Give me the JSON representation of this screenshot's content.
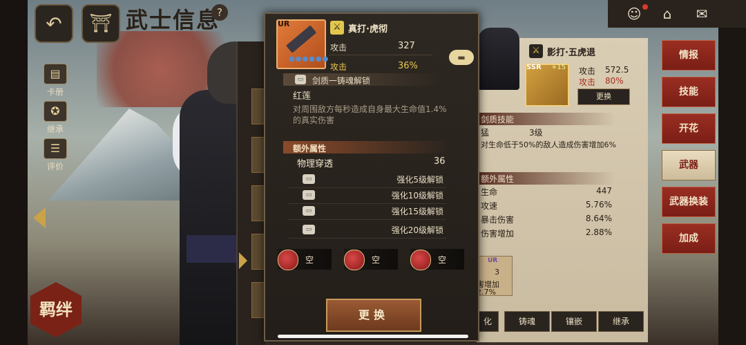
{
  "header": {
    "title": "武士信息",
    "help": "?"
  },
  "left_menu": [
    {
      "label": "卡册",
      "icon": "card-album-icon"
    },
    {
      "label": "继承",
      "icon": "inherit-icon"
    },
    {
      "label": "评价",
      "icon": "review-icon"
    }
  ],
  "bond_badge": "羁绊",
  "popup": {
    "weapon": {
      "rarity": "UR",
      "name": "真打·虎彻",
      "dots": "●●●●●●"
    },
    "stats": [
      {
        "label": "攻击",
        "value": "327"
      },
      {
        "label": "攻击",
        "value": "36%"
      }
    ],
    "skill": {
      "title": "剑质一铸魂解锁",
      "name": "红莲",
      "description": "对周围敌方每秒造成自身最大生命值1.4%的真实伤害"
    },
    "extra": {
      "title": "额外属性",
      "stat_label": "物理穿透",
      "stat_value": "36",
      "locks": [
        "强化5级解锁",
        "强化10级解锁",
        "强化15级解锁",
        "强化20级解锁"
      ]
    },
    "gems": [
      "空",
      "空",
      "空"
    ],
    "replace_button": "更换"
  },
  "right_panel": {
    "weapon_name": "影打·五虎退",
    "rarity": "SSR",
    "plus": "+15",
    "stats": [
      {
        "label": "攻击",
        "value": "572.5"
      },
      {
        "label": "攻击",
        "value": "80%"
      }
    ],
    "replace_button": "更换",
    "skill_title": "剑质技能",
    "skill_name": "猛",
    "skill_level": "3级",
    "skill_desc": "对生命低于50%的敌人造成伤害增加6%",
    "extra_title": "额外属性",
    "extra_rows": [
      {
        "label": "生命",
        "value": "447"
      },
      {
        "label": "攻速",
        "value": "5.76%"
      },
      {
        "label": "暴击伤害",
        "value": "8.64%"
      },
      {
        "label": "伤害增加",
        "value": "2.88%"
      }
    ],
    "bond": {
      "rank": "UR",
      "num": "3",
      "label": "害增加",
      "value": "2.7%"
    },
    "bottom_buttons": [
      "化",
      "铸魂",
      "镶嵌",
      "继承"
    ]
  },
  "tabs": [
    {
      "label": "情报",
      "active": false
    },
    {
      "label": "技能",
      "active": false
    },
    {
      "label": "开花",
      "active": false
    },
    {
      "label": "武器",
      "active": true
    },
    {
      "label": "武器换装",
      "active": false
    },
    {
      "label": "加成",
      "active": false
    }
  ],
  "colors": {
    "accent_red": "#7a1e16",
    "gold": "#e8c850",
    "panel_dark": "#2e2822"
  }
}
